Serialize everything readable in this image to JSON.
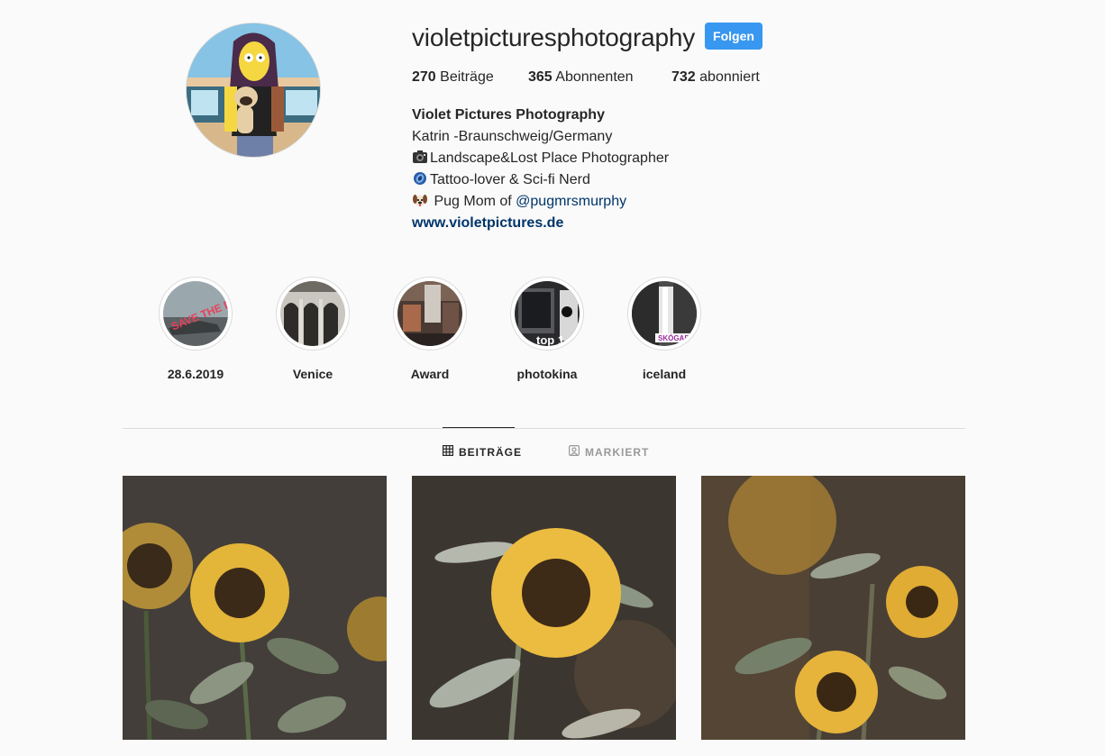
{
  "profile": {
    "username": "violetpicturesphotography",
    "follow_label": "Folgen",
    "stats": {
      "posts_count": "270",
      "posts_label": "Beiträge",
      "followers_count": "365",
      "followers_label": "Abonnenten",
      "following_count": "732",
      "following_label": "abonniert"
    },
    "bio": {
      "full_name": "Violet Pictures Photography",
      "line1": "Katrin -Braunschweig/Germany",
      "line2": "Landscape&Lost Place Photographer",
      "line3": "Tattoo-lover & Sci-fi Nerd",
      "line4_prefix": " Pug Mom of ",
      "line4_mention": "@pugmrsmurphy",
      "website": "www.violetpictures.de"
    }
  },
  "highlights": [
    {
      "label": "28.6.2019"
    },
    {
      "label": "Venice"
    },
    {
      "label": "Award"
    },
    {
      "label": "photokina"
    },
    {
      "label": "iceland"
    }
  ],
  "highlight_overlays": {
    "save_the_date": "SAVE THE DATE!",
    "top": "top 1",
    "skogafoss": "SKÓGAFOS"
  },
  "tabs": [
    {
      "label": "BEITRÄGE",
      "icon": "grid-icon",
      "active": true
    },
    {
      "label": "MARKIERT",
      "icon": "tagged-icon",
      "active": false
    }
  ],
  "colors": {
    "accent": "#3897f0",
    "link": "#003569",
    "text": "#262626",
    "background": "#fafafa"
  },
  "icons": {
    "camera_emoji": "camera-icon",
    "lens_emoji": "blue-lens-icon",
    "pug_emoji": "dog-face-icon"
  }
}
